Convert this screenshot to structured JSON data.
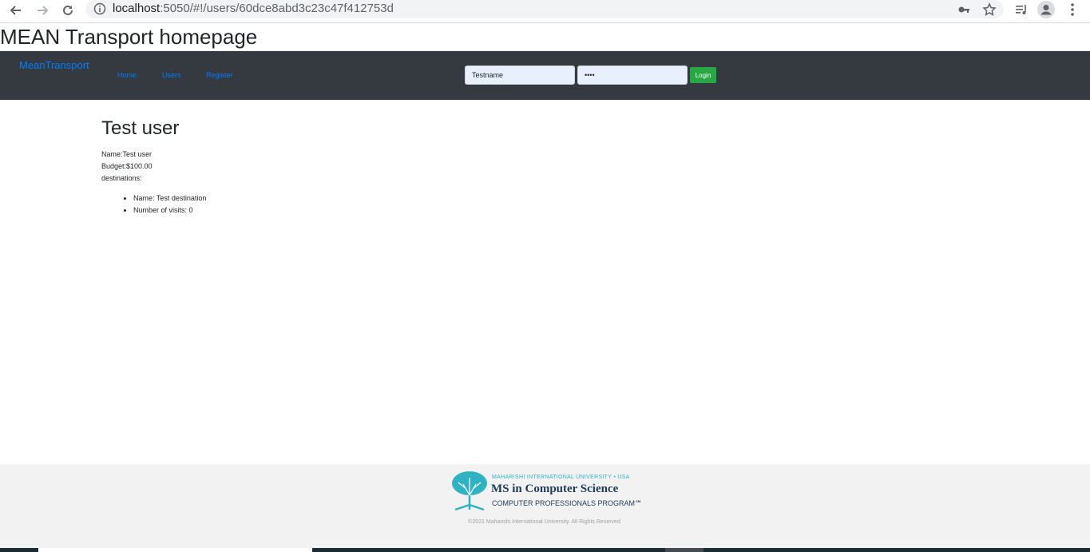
{
  "browser": {
    "url_host": "localhost",
    "url_path": ":5050/#!/users/60dce8abd3c23c47f412753d"
  },
  "page": {
    "heading": "MEAN Transport homepage"
  },
  "navbar": {
    "brand": "MeanTransport",
    "links": [
      "Home",
      "Users",
      "Register"
    ],
    "username_value": "Testname",
    "password_value": "••••",
    "login_label": "Login",
    "colors": {
      "background": "#343a40",
      "link": "#007bff",
      "login": "#28a745"
    }
  },
  "user": {
    "title": "Test user",
    "name_line": "Name:Test user",
    "budget_line": "Budget:$100.00",
    "destinations_label": "destinations:",
    "destination_items": [
      "Name: Test destination",
      "Number of visits: 0"
    ]
  },
  "footer": {
    "logo_subtitle": "MAHARISHI INTERNATIONAL UNIVERSITY • USA",
    "logo_title": "MS in Computer Science",
    "logo_program": "COMPUTER PROFESSIONALS PROGRAM℠",
    "copyright": "©2021 Maharishi International University. All Rights Reserved."
  }
}
